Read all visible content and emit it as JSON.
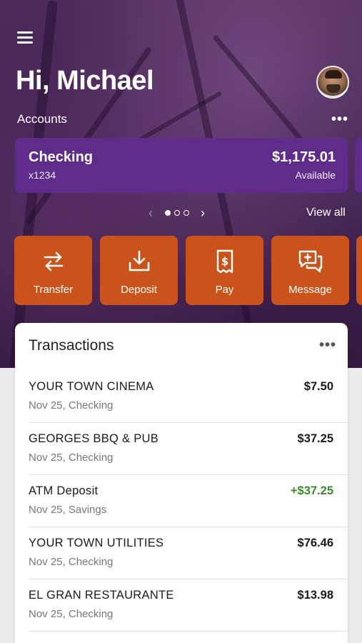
{
  "header": {
    "greeting": "Hi, Michael",
    "accounts_label": "Accounts",
    "accounts_more": "•••",
    "menu_icon": "hamburger-menu-icon",
    "avatar_icon": "user-avatar"
  },
  "account": {
    "name": "Checking",
    "number": "x1234",
    "balance": "$1,175.01",
    "balance_label": "Available"
  },
  "pager": {
    "current_page": 1,
    "total_pages": 3,
    "prev_icon": "chevron-left-icon",
    "next_icon": "chevron-right-icon",
    "view_all": "View all"
  },
  "actions": [
    {
      "label": "Transfer",
      "icon": "transfer-arrows-icon"
    },
    {
      "label": "Deposit",
      "icon": "deposit-download-icon"
    },
    {
      "label": "Pay",
      "icon": "pay-bill-icon"
    },
    {
      "label": "Message",
      "icon": "message-chat-icon"
    }
  ],
  "transactions": {
    "title": "Transactions",
    "more": "•••",
    "items": [
      {
        "merchant": "YOUR TOWN CINEMA",
        "detail": "Nov 25, Checking",
        "amount": "$7.50",
        "positive": false
      },
      {
        "merchant": "GEORGES BBQ & PUB",
        "detail": "Nov 25, Checking",
        "amount": "$37.25",
        "positive": false
      },
      {
        "merchant": "ATM Deposit",
        "detail": "Nov 25, Savings",
        "amount": "+$37.25",
        "positive": true
      },
      {
        "merchant": "YOUR TOWN UTILITIES",
        "detail": "Nov 25, Checking",
        "amount": "$76.46",
        "positive": false
      },
      {
        "merchant": "EL GRAN RESTAURANTE",
        "detail": "Nov 25, Checking",
        "amount": "$13.98",
        "positive": false
      }
    ]
  },
  "colors": {
    "hero": "#3f2150",
    "card": "#5f2c8c",
    "action": "#c9531a",
    "positive": "#3b8a2a"
  }
}
